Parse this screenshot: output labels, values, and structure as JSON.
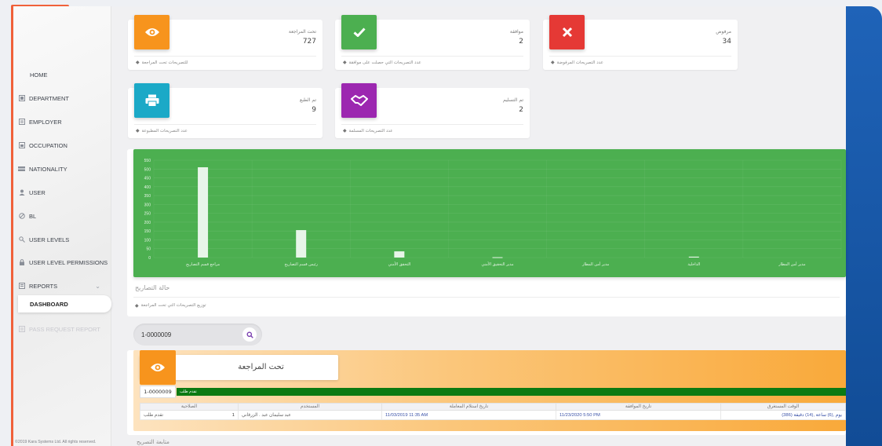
{
  "sidebar": {
    "items": [
      {
        "label": "HOME",
        "icon": "home-icon"
      },
      {
        "label": "DEPARTMENT",
        "icon": "department-icon"
      },
      {
        "label": "EMPLOYER",
        "icon": "employer-icon"
      },
      {
        "label": "OCCUPATION",
        "icon": "occupation-icon"
      },
      {
        "label": "NATIONALITY",
        "icon": "flag-icon"
      },
      {
        "label": "USER",
        "icon": "user-icon"
      },
      {
        "label": "BL",
        "icon": "blacklist-icon"
      },
      {
        "label": "USER LEVELS",
        "icon": "key-icon"
      },
      {
        "label": "USER LEVEL PERMISSIONS",
        "icon": "lock-icon"
      },
      {
        "label": "REPORTS",
        "icon": "reports-icon"
      },
      {
        "label": "DASHBOARD",
        "icon": ""
      },
      {
        "label": "PASS REQUEST REPORT",
        "icon": "document-icon"
      }
    ],
    "footer": "©2019 Kara Systems Ltd. All rights reserved."
  },
  "stats": [
    {
      "title": "تحت المراجعة",
      "value": "727",
      "footer": "للتصريحات تحت المراجعة",
      "color": "#f7941d",
      "icon": "eye-icon"
    },
    {
      "title": "موافقة",
      "value": "2",
      "footer": "عدد التصريحات التي حصلت على موافقة",
      "color": "#4caf50",
      "icon": "check-icon"
    },
    {
      "title": "مرفوض",
      "value": "34",
      "footer": "عدد التصريحات المرفوضة",
      "color": "#e53935",
      "icon": "close-icon"
    },
    {
      "title": "تم الطبع",
      "value": "9",
      "footer": "عدد التصريحات المطبوعة",
      "color": "#1ba9c7",
      "icon": "printer-icon"
    },
    {
      "title": "تم التسليم",
      "value": "2",
      "footer": "عدد التصريحات المسلمة",
      "color": "#9c27b0",
      "icon": "handshake-icon"
    }
  ],
  "chart_data": {
    "type": "bar",
    "categories": [
      "مراجع قسم التصاريح",
      "رئيس قسم التصاريح",
      "التحقق الأمني",
      "مدير التحقيق الأمني",
      "مدير أمن المطار",
      "الداخلية",
      "مدير أمن المطار"
    ],
    "values": [
      510,
      155,
      35,
      2,
      0,
      5,
      0
    ],
    "ylim": [
      0,
      550
    ],
    "yticks": [
      0,
      50,
      100,
      150,
      200,
      250,
      300,
      350,
      400,
      450,
      500,
      550
    ],
    "grid": true,
    "panel_color": "#4caf50",
    "bar_color": "#e8f5e9",
    "title": "حالة التصاريح",
    "footer": "توزيع التصريحات التي تحت المراجعة"
  },
  "search": {
    "value": "1-0000009"
  },
  "review": {
    "title": "تحت المراجعة",
    "chip": "1-0000009",
    "strip": "تقدم طلب",
    "columns": [
      "الصلاحية",
      "المستخدم",
      "تاريخ استلام المعاملة",
      "تاريخ الموافقة",
      "الوقت المستغرق"
    ],
    "row": {
      "num": "1",
      "permission": "تقدم طلب",
      "user": "عبد سليمان عبد . الزرقاني",
      "received": "11/03/2019 11:35 AM",
      "approved": "11/23/2020 5:50 PM",
      "elapsed": "(386) يوم ,(6) ساعة ,(14) دقيقة"
    }
  },
  "bottom_text": "متابعة التصريح"
}
